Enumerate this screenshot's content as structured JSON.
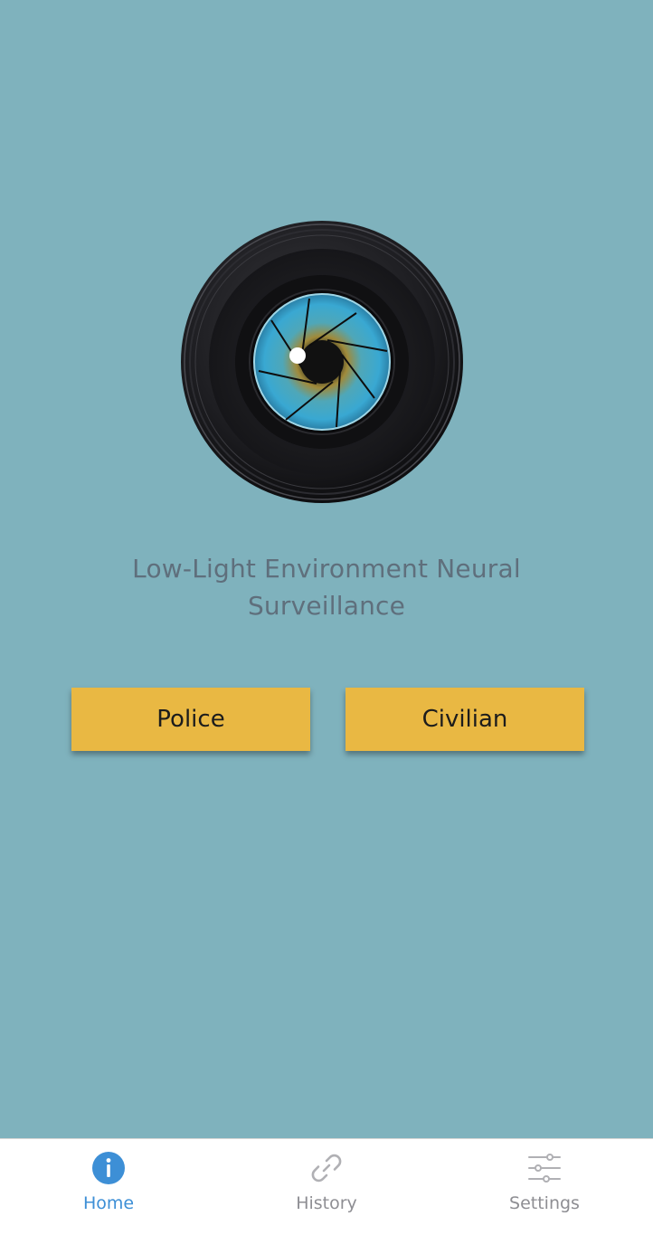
{
  "app": {
    "title": "Low-Light Environment Neural Surveillance",
    "title_line1": "Low-Light Environment Neural",
    "title_line2": "Surveillance",
    "logo_icon": "camera-lens-eye-icon"
  },
  "actions": {
    "police_label": "Police",
    "civilian_label": "Civilian"
  },
  "tabbar": {
    "tabs": [
      {
        "label": "Home",
        "icon": "info-icon",
        "active": true
      },
      {
        "label": "History",
        "icon": "link-icon",
        "active": false
      },
      {
        "label": "Settings",
        "icon": "sliders-icon",
        "active": false
      }
    ]
  },
  "colors": {
    "background": "#7fb2bd",
    "button": "#e9b843",
    "title_text": "#5f6f7c",
    "active_tab": "#3d8fd6",
    "inactive_tab": "#8e8e93"
  }
}
